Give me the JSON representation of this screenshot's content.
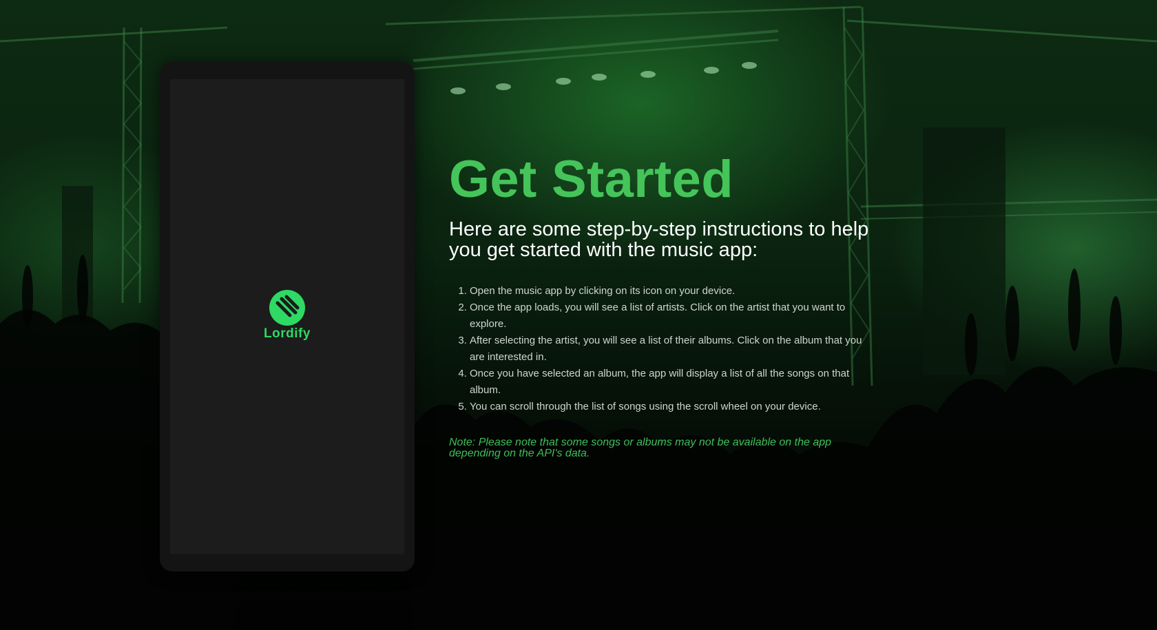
{
  "background": {
    "description_icon": "concert-crowd-stage-image"
  },
  "phone": {
    "logo_icon": "lordify-logo-icon",
    "app_name": "Lordify",
    "brand_color": "#2ed964",
    "screen_color": "#1c1c1c"
  },
  "content": {
    "title": "Get Started",
    "subtitle": "Here are some step-by-step instructions to help you get started with the music app:",
    "steps": [
      "Open the music app by clicking on its icon on your device.",
      "Once the app loads, you will see a list of artists. Click on the artist that you want to explore.",
      "After selecting the artist, you will see a list of their albums. Click on the album that you are interested in.",
      "Once you have selected an album, the app will display a list of all the songs on that album.",
      "You can scroll through the list of songs using the scroll wheel on your device."
    ],
    "note": "Note: Please note that some songs or albums may not be available on the app depending on the API's data.",
    "accent_color": "#45c45a"
  }
}
